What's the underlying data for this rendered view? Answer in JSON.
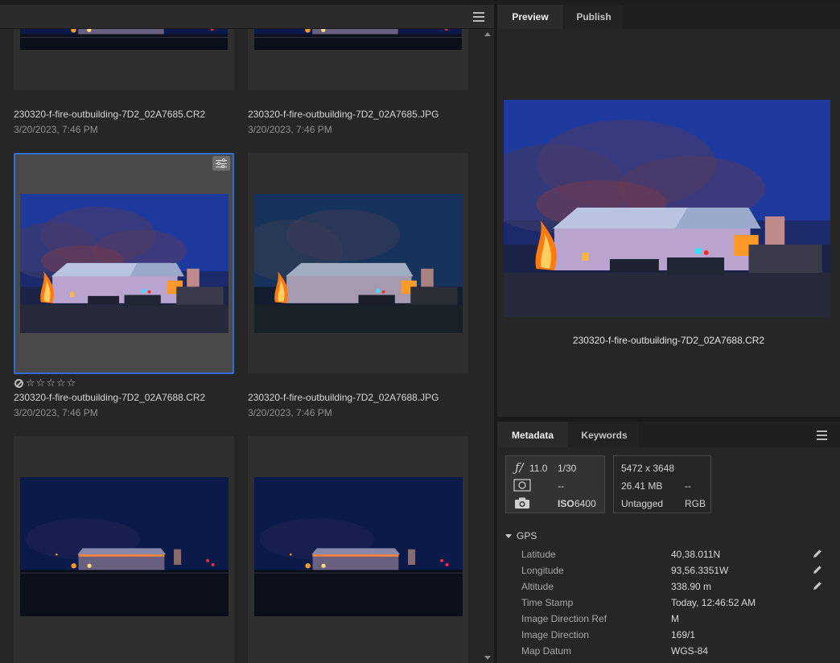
{
  "colors": {
    "panel_bg": "#262626",
    "card_bg": "#2f2f2f",
    "card_selected_bg": "#4a4a4a",
    "selection_border": "#2d6fd6",
    "night_sky": "#1f3a9e",
    "fire": "#ff8a1e"
  },
  "content": {
    "menu_icon": "hamburger-icon",
    "items": [
      {
        "name": "230320-f-fire-outbuilding-7D2_02A7685.CR2",
        "date": "3/20/2023, 7:46 PM"
      },
      {
        "name": "230320-f-fire-outbuilding-7D2_02A7685.JPG",
        "date": "3/20/2023, 7:46 PM"
      },
      {
        "name": "230320-f-fire-outbuilding-7D2_02A7688.CR2",
        "date": "3/20/2023, 7:46 PM",
        "selected": true,
        "rating": 0
      },
      {
        "name": "230320-f-fire-outbuilding-7D2_02A7688.JPG",
        "date": "3/20/2023, 7:46 PM"
      },
      {
        "name": "",
        "date": ""
      },
      {
        "name": "",
        "date": ""
      }
    ]
  },
  "preview": {
    "tabs": [
      {
        "label": "Preview",
        "active": true
      },
      {
        "label": "Publish",
        "active": false
      }
    ],
    "caption": "230320-f-fire-outbuilding-7D2_02A7688.CR2"
  },
  "metadata": {
    "tabs": [
      {
        "label": "Metadata",
        "active": true
      },
      {
        "label": "Keywords",
        "active": false
      }
    ],
    "exposure": {
      "aperture": "11.0",
      "shutter": "1/30",
      "metering": "--",
      "iso_label": "ISO",
      "iso": "6400"
    },
    "file_info": {
      "dimensions": "5472 x 3648",
      "size": "26.41 MB",
      "size_extra": "--",
      "color_profile": "Untagged",
      "color_mode": "RGB"
    },
    "gps": {
      "section_label": "GPS",
      "rows": [
        {
          "label": "Latitude",
          "value": "40,38.011N",
          "editable": true
        },
        {
          "label": "Longitude",
          "value": "93,56.3351W",
          "editable": true
        },
        {
          "label": "Altitude",
          "value": "338.90 m",
          "editable": true
        },
        {
          "label": "Time Stamp",
          "value": "Today, 12:46:52 AM",
          "editable": false
        },
        {
          "label": "Image Direction Ref",
          "value": "M",
          "editable": false
        },
        {
          "label": "Image Direction",
          "value": "169/1",
          "editable": false
        },
        {
          "label": "Map Datum",
          "value": "WGS-84",
          "editable": false
        }
      ]
    }
  }
}
